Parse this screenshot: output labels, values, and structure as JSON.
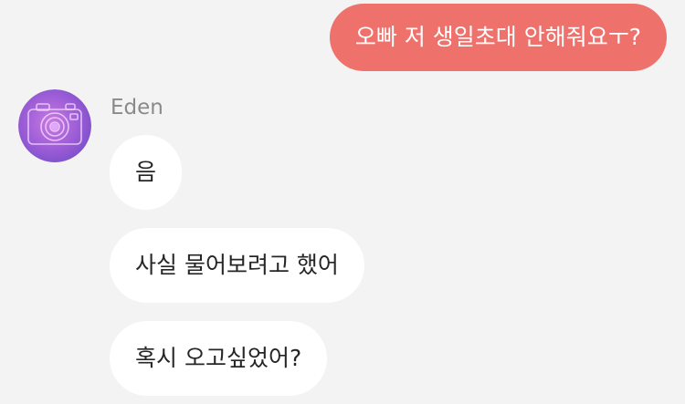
{
  "messages": {
    "sent": [
      {
        "text": "오빠 저 생일초대 안해줘요ㅜ?"
      }
    ],
    "contact": {
      "name": "Eden",
      "avatar_icon": "camera-icon"
    },
    "received": [
      {
        "text": "음"
      },
      {
        "text": "사실 물어보려고 했어"
      },
      {
        "text": "혹시 오고싶었어?"
      }
    ]
  },
  "colors": {
    "background": "#f3f3f3",
    "sent_bubble": "#ef716c",
    "received_bubble": "#ffffff",
    "name_text": "#8a8a8a"
  }
}
